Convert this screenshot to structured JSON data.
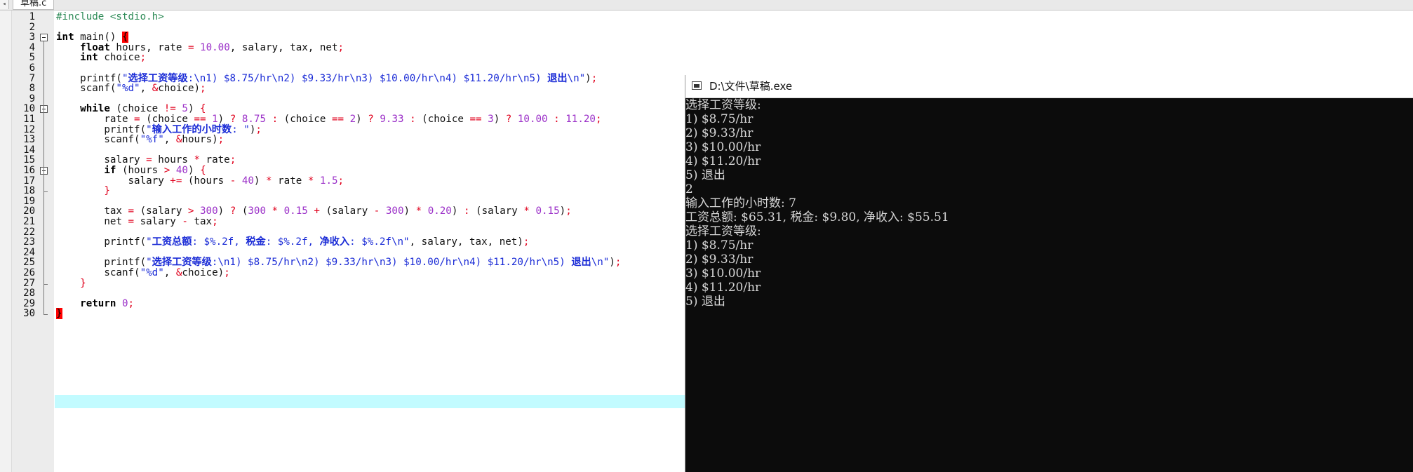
{
  "tab": {
    "filename": "草稿.c",
    "left_arrow": "◂"
  },
  "editor": {
    "line_numbers": [
      "1",
      "2",
      "3",
      "4",
      "5",
      "6",
      "7",
      "8",
      "9",
      "10",
      "11",
      "12",
      "13",
      "14",
      "15",
      "16",
      "17",
      "18",
      "19",
      "20",
      "21",
      "22",
      "23",
      "24",
      "25",
      "26",
      "27",
      "28",
      "29",
      "30"
    ],
    "lines": [
      [
        {
          "t": "#include <stdio.h>",
          "c": "pp"
        }
      ],
      [],
      [
        {
          "t": "int",
          "c": "kw"
        },
        {
          "t": " main() "
        },
        {
          "t": "{",
          "c": "hlbrace"
        }
      ],
      [
        {
          "t": "    "
        },
        {
          "t": "float",
          "c": "kw"
        },
        {
          "t": " hours, rate "
        },
        {
          "t": "=",
          "c": "op"
        },
        {
          "t": " "
        },
        {
          "t": "10.00",
          "c": "num"
        },
        {
          "t": ", salary, tax, net"
        },
        {
          "t": ";",
          "c": "op"
        }
      ],
      [
        {
          "t": "    "
        },
        {
          "t": "int",
          "c": "kw"
        },
        {
          "t": " choice"
        },
        {
          "t": ";",
          "c": "op"
        }
      ],
      [],
      [
        {
          "t": "    printf("
        },
        {
          "t": "\"",
          "c": "str"
        },
        {
          "t": "选择工资等级",
          "c": "strcn"
        },
        {
          "t": ":\\n1) $8.75/hr\\n2) $9.33/hr\\n3) $10.00/hr\\n4) $11.20/hr\\n5) ",
          "c": "str"
        },
        {
          "t": "退出",
          "c": "strcn"
        },
        {
          "t": "\\n\"",
          "c": "str"
        },
        {
          "t": ")"
        },
        {
          "t": ";",
          "c": "op"
        }
      ],
      [
        {
          "t": "    scanf("
        },
        {
          "t": "\"%d\"",
          "c": "str"
        },
        {
          "t": ", "
        },
        {
          "t": "&",
          "c": "op"
        },
        {
          "t": "choice)"
        },
        {
          "t": ";",
          "c": "op"
        }
      ],
      [],
      [
        {
          "t": "    "
        },
        {
          "t": "while",
          "c": "kw"
        },
        {
          "t": " (choice "
        },
        {
          "t": "!=",
          "c": "op"
        },
        {
          "t": " "
        },
        {
          "t": "5",
          "c": "num"
        },
        {
          "t": ") "
        },
        {
          "t": "{",
          "c": "brace"
        }
      ],
      [
        {
          "t": "        rate "
        },
        {
          "t": "=",
          "c": "op"
        },
        {
          "t": " (choice "
        },
        {
          "t": "==",
          "c": "op"
        },
        {
          "t": " "
        },
        {
          "t": "1",
          "c": "num"
        },
        {
          "t": ") "
        },
        {
          "t": "?",
          "c": "op"
        },
        {
          "t": " "
        },
        {
          "t": "8.75",
          "c": "num"
        },
        {
          "t": " "
        },
        {
          "t": ":",
          "c": "op"
        },
        {
          "t": " (choice "
        },
        {
          "t": "==",
          "c": "op"
        },
        {
          "t": " "
        },
        {
          "t": "2",
          "c": "num"
        },
        {
          "t": ") "
        },
        {
          "t": "?",
          "c": "op"
        },
        {
          "t": " "
        },
        {
          "t": "9.33",
          "c": "num"
        },
        {
          "t": " "
        },
        {
          "t": ":",
          "c": "op"
        },
        {
          "t": " (choice "
        },
        {
          "t": "==",
          "c": "op"
        },
        {
          "t": " "
        },
        {
          "t": "3",
          "c": "num"
        },
        {
          "t": ") "
        },
        {
          "t": "?",
          "c": "op"
        },
        {
          "t": " "
        },
        {
          "t": "10.00",
          "c": "num"
        },
        {
          "t": " "
        },
        {
          "t": ":",
          "c": "op"
        },
        {
          "t": " "
        },
        {
          "t": "11.20",
          "c": "num"
        },
        {
          "t": ";",
          "c": "op"
        }
      ],
      [
        {
          "t": "        printf("
        },
        {
          "t": "\"",
          "c": "str"
        },
        {
          "t": "输入工作的小时数",
          "c": "strcn"
        },
        {
          "t": ": \"",
          "c": "str"
        },
        {
          "t": ")"
        },
        {
          "t": ";",
          "c": "op"
        }
      ],
      [
        {
          "t": "        scanf("
        },
        {
          "t": "\"%f\"",
          "c": "str"
        },
        {
          "t": ", "
        },
        {
          "t": "&",
          "c": "op"
        },
        {
          "t": "hours)"
        },
        {
          "t": ";",
          "c": "op"
        }
      ],
      [],
      [
        {
          "t": "        salary "
        },
        {
          "t": "=",
          "c": "op"
        },
        {
          "t": " hours "
        },
        {
          "t": "*",
          "c": "op"
        },
        {
          "t": " rate"
        },
        {
          "t": ";",
          "c": "op"
        }
      ],
      [
        {
          "t": "        "
        },
        {
          "t": "if",
          "c": "kw"
        },
        {
          "t": " (hours "
        },
        {
          "t": ">",
          "c": "op"
        },
        {
          "t": " "
        },
        {
          "t": "40",
          "c": "num"
        },
        {
          "t": ") "
        },
        {
          "t": "{",
          "c": "brace"
        }
      ],
      [
        {
          "t": "            salary "
        },
        {
          "t": "+=",
          "c": "op"
        },
        {
          "t": " (hours "
        },
        {
          "t": "-",
          "c": "op"
        },
        {
          "t": " "
        },
        {
          "t": "40",
          "c": "num"
        },
        {
          "t": ") "
        },
        {
          "t": "*",
          "c": "op"
        },
        {
          "t": " rate "
        },
        {
          "t": "*",
          "c": "op"
        },
        {
          "t": " "
        },
        {
          "t": "1.5",
          "c": "num"
        },
        {
          "t": ";",
          "c": "op"
        }
      ],
      [
        {
          "t": "        "
        },
        {
          "t": "}",
          "c": "brace"
        }
      ],
      [],
      [
        {
          "t": "        tax "
        },
        {
          "t": "=",
          "c": "op"
        },
        {
          "t": " (salary "
        },
        {
          "t": ">",
          "c": "op"
        },
        {
          "t": " "
        },
        {
          "t": "300",
          "c": "num"
        },
        {
          "t": ") "
        },
        {
          "t": "?",
          "c": "op"
        },
        {
          "t": " ("
        },
        {
          "t": "300",
          "c": "num"
        },
        {
          "t": " "
        },
        {
          "t": "*",
          "c": "op"
        },
        {
          "t": " "
        },
        {
          "t": "0.15",
          "c": "num"
        },
        {
          "t": " "
        },
        {
          "t": "+",
          "c": "op"
        },
        {
          "t": " (salary "
        },
        {
          "t": "-",
          "c": "op"
        },
        {
          "t": " "
        },
        {
          "t": "300",
          "c": "num"
        },
        {
          "t": ") "
        },
        {
          "t": "*",
          "c": "op"
        },
        {
          "t": " "
        },
        {
          "t": "0.20",
          "c": "num"
        },
        {
          "t": ") "
        },
        {
          "t": ":",
          "c": "op"
        },
        {
          "t": " (salary "
        },
        {
          "t": "*",
          "c": "op"
        },
        {
          "t": " "
        },
        {
          "t": "0.15",
          "c": "num"
        },
        {
          "t": ")"
        },
        {
          "t": ";",
          "c": "op"
        }
      ],
      [
        {
          "t": "        net "
        },
        {
          "t": "=",
          "c": "op"
        },
        {
          "t": " salary "
        },
        {
          "t": "-",
          "c": "op"
        },
        {
          "t": " tax"
        },
        {
          "t": ";",
          "c": "op"
        }
      ],
      [],
      [
        {
          "t": "        printf("
        },
        {
          "t": "\"",
          "c": "str"
        },
        {
          "t": "工资总额",
          "c": "strcn"
        },
        {
          "t": ": $%.2f, ",
          "c": "str"
        },
        {
          "t": "税金",
          "c": "strcn"
        },
        {
          "t": ": $%.2f, ",
          "c": "str"
        },
        {
          "t": "净收入",
          "c": "strcn"
        },
        {
          "t": ": $%.2f\\n\"",
          "c": "str"
        },
        {
          "t": ", salary, tax, net)"
        },
        {
          "t": ";",
          "c": "op"
        }
      ],
      [],
      [
        {
          "t": "        printf("
        },
        {
          "t": "\"",
          "c": "str"
        },
        {
          "t": "选择工资等级",
          "c": "strcn"
        },
        {
          "t": ":\\n1) $8.75/hr\\n2) $9.33/hr\\n3) $10.00/hr\\n4) $11.20/hr\\n5) ",
          "c": "str"
        },
        {
          "t": "退出",
          "c": "strcn"
        },
        {
          "t": "\\n\"",
          "c": "str"
        },
        {
          "t": ")"
        },
        {
          "t": ";",
          "c": "op"
        }
      ],
      [
        {
          "t": "        scanf("
        },
        {
          "t": "\"%d\"",
          "c": "str"
        },
        {
          "t": ", "
        },
        {
          "t": "&",
          "c": "op"
        },
        {
          "t": "choice)"
        },
        {
          "t": ";",
          "c": "op"
        }
      ],
      [
        {
          "t": "    "
        },
        {
          "t": "}",
          "c": "brace"
        }
      ],
      [],
      [
        {
          "t": "    "
        },
        {
          "t": "return",
          "c": "kw"
        },
        {
          "t": " "
        },
        {
          "t": "0",
          "c": "num"
        },
        {
          "t": ";",
          "c": "op"
        }
      ],
      [
        {
          "t": "}",
          "c": "hlbrace"
        }
      ]
    ]
  },
  "console": {
    "title": "D:\\文件\\草稿.exe",
    "lines": [
      "选择工资等级:",
      "1) $8.75/hr",
      "2) $9.33/hr",
      "3) $10.00/hr",
      "4) $11.20/hr",
      "5) 退出",
      "2",
      "输入工作的小时数: 7",
      "工资总额: $65.31, 税金: $9.80, 净收入: $55.51",
      "选择工资等级:",
      "1) $8.75/hr",
      "2) $9.33/hr",
      "3) $10.00/hr",
      "4) $11.20/hr",
      "5) 退出"
    ]
  }
}
